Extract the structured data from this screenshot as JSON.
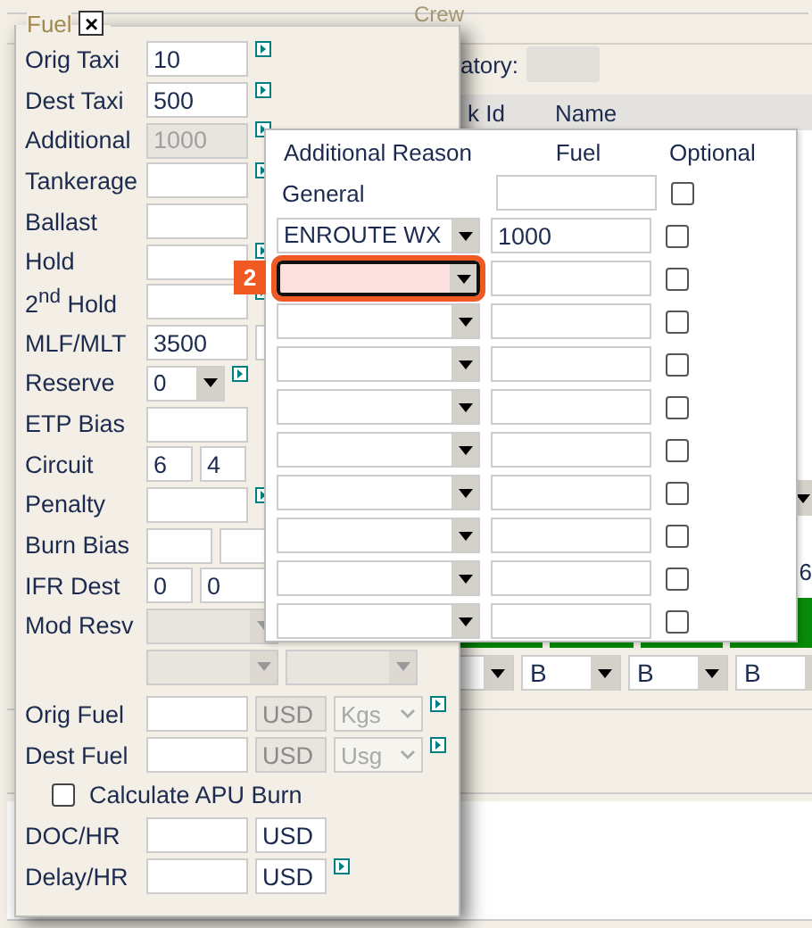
{
  "background": {
    "legend": "Crew",
    "field_label": "atory:",
    "columns": [
      "k Id",
      "Name"
    ],
    "side_value": "6",
    "grade_selects": [
      {
        "kind": "arrow_only"
      },
      {
        "kind": "select",
        "value": "B"
      },
      {
        "kind": "select",
        "value": "B"
      },
      {
        "kind": "select",
        "value": "B"
      }
    ]
  },
  "fuel_panel": {
    "title": "Fuel",
    "close": "×",
    "rows": [
      {
        "label": "Orig Taxi",
        "link": true,
        "fields": [
          {
            "kind": "input",
            "value": "10",
            "disabled": false
          }
        ]
      },
      {
        "label": "Dest Taxi",
        "link": true,
        "fields": [
          {
            "kind": "input",
            "value": "500",
            "disabled": false
          }
        ]
      },
      {
        "label": "Additional",
        "link": true,
        "fields": [
          {
            "kind": "input",
            "value": "1000",
            "disabled": true
          }
        ]
      },
      {
        "label": "Tankerage",
        "link": true,
        "fields": [
          {
            "kind": "input",
            "disabled": false
          }
        ]
      },
      {
        "label": "Ballast",
        "link": false,
        "fields": [
          {
            "kind": "input",
            "disabled": false
          }
        ]
      },
      {
        "label": "Hold",
        "link": true,
        "fields": [
          {
            "kind": "input",
            "disabled": false
          }
        ]
      },
      {
        "label": "2$^{nd}$ Hold",
        "link": true,
        "fields": [
          {
            "kind": "input",
            "disabled": false
          }
        ]
      },
      {
        "label": "MLF/MLT",
        "link": false,
        "fields": [
          {
            "kind": "input",
            "value": "3500",
            "disabled": false
          },
          {
            "kind": "input",
            "disabled": false
          }
        ]
      },
      {
        "label": "Reserve",
        "link": true,
        "fields": [
          {
            "kind": "select",
            "value": "0",
            "disabled": false
          }
        ]
      },
      {
        "label": "ETP Bias",
        "link": false,
        "fields": [
          {
            "kind": "input",
            "disabled": false
          }
        ]
      },
      {
        "label": "Circuit",
        "link": false,
        "fields": [
          {
            "kind": "half",
            "value": "6",
            "disabled": false
          },
          {
            "kind": "half",
            "value": "4",
            "disabled": false
          }
        ]
      },
      {
        "label": "Penalty",
        "link": true,
        "fields": [
          {
            "kind": "input",
            "disabled": false
          }
        ]
      },
      {
        "label": "Burn Bias",
        "link": false,
        "fields": [
          {
            "kind": "mid",
            "disabled": false
          },
          {
            "kind": "mid",
            "disabled": false
          }
        ]
      },
      {
        "label": "IFR Dest",
        "link": false,
        "fields": [
          {
            "kind": "half",
            "value": "0",
            "disabled": false
          },
          {
            "kind": "input",
            "value": "0",
            "disabled": false
          }
        ]
      },
      {
        "label": "Mod Resv",
        "link": false,
        "fields": [
          {
            "kind": "wide_select",
            "disabled": true
          }
        ]
      },
      {
        "link": false,
        "fields": [
          {
            "kind": "wide_select",
            "disabled": true
          },
          {
            "kind": "wide_select",
            "disabled": true
          }
        ]
      },
      {
        "label": "Orig Fuel",
        "link": true,
        "fields": [
          {
            "kind": "input",
            "disabled": false
          },
          {
            "kind": "unit",
            "value": "USD",
            "disabled": true
          },
          {
            "kind": "unit_select",
            "value": "Kgs",
            "disabled": true
          }
        ]
      },
      {
        "label": "Dest Fuel",
        "link": true,
        "fields": [
          {
            "kind": "input",
            "disabled": false
          },
          {
            "kind": "unit",
            "value": "USD",
            "disabled": true
          },
          {
            "kind": "unit_select",
            "value": "Usg",
            "disabled": true
          }
        ]
      },
      {
        "kind": "checkbox",
        "label": "Calculate APU Burn",
        "checked": false
      },
      {
        "label": "DOC/HR",
        "link": false,
        "fields": [
          {
            "kind": "input",
            "disabled": false
          },
          {
            "kind": "unit",
            "value": "USD",
            "disabled": false
          }
        ]
      },
      {
        "label": "Delay/HR",
        "link": true,
        "fields": [
          {
            "kind": "input",
            "disabled": false
          },
          {
            "kind": "unit",
            "value": "USD",
            "disabled": false
          }
        ]
      }
    ]
  },
  "additional_popup": {
    "columns": [
      "Additional Reason",
      "Fuel",
      "Optional"
    ],
    "rows": [
      {
        "kind": "label",
        "reason": "General",
        "optional": false
      },
      {
        "kind": "select",
        "reason": "ENROUTE WX",
        "fuel": "1000",
        "optional": false
      },
      {
        "kind": "select",
        "optional": false,
        "badge": "2"
      },
      {
        "kind": "select",
        "optional": false
      },
      {
        "kind": "select",
        "optional": false
      },
      {
        "kind": "select",
        "optional": false
      },
      {
        "kind": "select",
        "optional": false
      },
      {
        "kind": "select",
        "optional": false
      },
      {
        "kind": "select",
        "optional": false
      },
      {
        "kind": "select",
        "optional": false
      },
      {
        "kind": "select",
        "optional": false
      }
    ]
  }
}
